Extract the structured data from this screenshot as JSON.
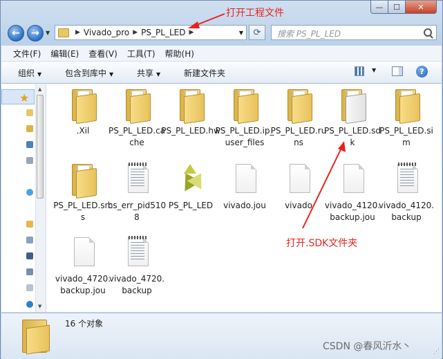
{
  "window": {
    "address": {
      "crumbs": [
        "Vivado_pro",
        "PS_PL_LED"
      ]
    },
    "search_placeholder": "搜索 PS_PL_LED"
  },
  "menubar": [
    "文件(F)",
    "编辑(E)",
    "查看(V)",
    "工具(T)",
    "帮助(H)"
  ],
  "toolbar": {
    "organize": "组织",
    "include": "包含到库中",
    "share": "共享",
    "new_folder": "新建文件夹"
  },
  "items": [
    {
      "label": ".Xil",
      "type": "folder"
    },
    {
      "label": "PS_PL_LED.cache",
      "type": "folder"
    },
    {
      "label": "PS_PL_LED.hw",
      "type": "folder"
    },
    {
      "label": "PS_PL_LED.ip_user_files",
      "type": "folder"
    },
    {
      "label": "PS_PL_LED.runs",
      "type": "folder"
    },
    {
      "label": "PS_PL_LED.sdk",
      "type": "folder"
    },
    {
      "label": "PS_PL_LED.sim",
      "type": "folder"
    },
    {
      "label": "PS_PL_LED.srcs",
      "type": "folder"
    },
    {
      "label": "hs_err_pid5108",
      "type": "text-file"
    },
    {
      "label": "PS_PL_LED",
      "type": "vivado-project"
    },
    {
      "label": "vivado.jou",
      "type": "blank-file"
    },
    {
      "label": "vivado",
      "type": "blank-file"
    },
    {
      "label": "vivado_4120.backup.jou",
      "type": "blank-file"
    },
    {
      "label": "vivado_4120.backup",
      "type": "text-file"
    },
    {
      "label": "vivado_4720.backup.jou",
      "type": "blank-file"
    },
    {
      "label": "vivado_4720.backup",
      "type": "text-file"
    }
  ],
  "status": {
    "count": "16 个对象"
  },
  "annotations": {
    "open_project": "打开工程文件",
    "open_sdk": "打开.SDK文件夹",
    "color": "#e8231c"
  },
  "watermark": "CSDN @春风沂水丶"
}
